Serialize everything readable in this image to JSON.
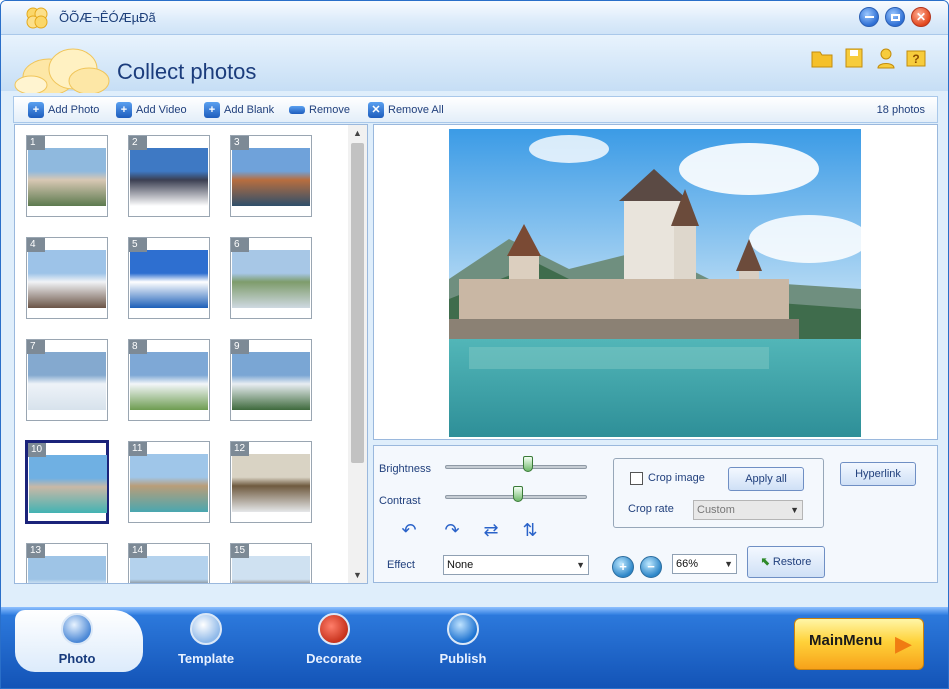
{
  "window": {
    "title": "ÕÕÆ¬ÊÓÆµÐã"
  },
  "header": {
    "title": "Collect photos",
    "icons": [
      "folder-icon",
      "save-icon",
      "user-icon",
      "help-icon"
    ]
  },
  "toolbar": {
    "add_photo": "Add Photo",
    "add_video": "Add Video",
    "add_blank": "Add Blank",
    "remove": "Remove",
    "remove_all": "Remove All",
    "photo_count": "18 photos"
  },
  "thumbnails": {
    "selected": "10",
    "items": [
      "1",
      "2",
      "3",
      "4",
      "5",
      "6",
      "7",
      "8",
      "9",
      "10",
      "11",
      "12",
      "13",
      "14",
      "15"
    ]
  },
  "controls": {
    "brightness_label": "Brightness",
    "brightness_level": 0.58,
    "contrast_label": "Contrast",
    "contrast_level": 0.51,
    "effect_label": "Effect",
    "effect_value": "None",
    "crop_label": "Crop image",
    "crop_checked": false,
    "apply_all": "Apply all",
    "crop_rate_label": "Crop rate",
    "crop_rate_value": "Custom",
    "hyperlink": "Hyperlink",
    "zoom_value": "66%",
    "restore": "Restore"
  },
  "nav": {
    "tabs": [
      {
        "label": "Photo",
        "active": true
      },
      {
        "label": "Template",
        "active": false
      },
      {
        "label": "Decorate",
        "active": false
      },
      {
        "label": "Publish",
        "active": false
      }
    ],
    "main_menu": "MainMenu"
  },
  "colors": {
    "accent": "#1b3c7c",
    "bottom_bar": "#1f66cc",
    "main_menu": "#ffd23a"
  }
}
